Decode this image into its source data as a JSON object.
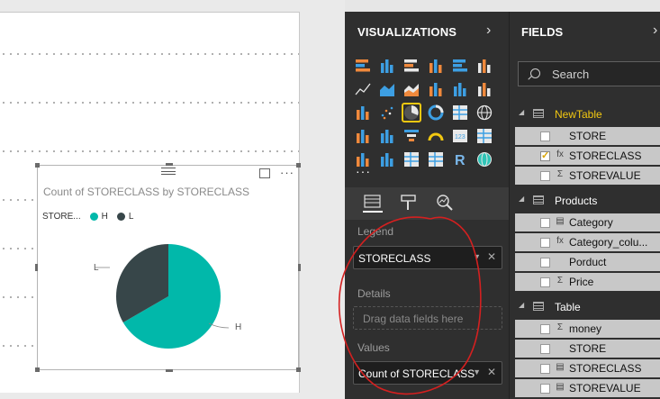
{
  "visual": {
    "title": "Count of STORECLASS by STORECLASS",
    "legend_title": "STORE...",
    "legend_items": [
      {
        "label": "H",
        "color": "#01b8aa"
      },
      {
        "label": "L",
        "color": "#374649"
      }
    ],
    "pie_labels": {
      "h": "H",
      "l": "L"
    }
  },
  "chart_data": {
    "type": "pie",
    "title": "Count of STORECLASS by STORECLASS",
    "legend_title": "STORE...",
    "slices": [
      {
        "label": "H",
        "value": 2,
        "color": "#01b8aa"
      },
      {
        "label": "L",
        "value": 1,
        "color": "#374649"
      }
    ]
  },
  "visualizations": {
    "header": "VISUALIZATIONS",
    "chevron": "›",
    "more": "···",
    "icons": [
      "stacked-bar-icon",
      "stacked-column-icon",
      "clustered-bar-icon",
      "clustered-column-icon",
      "100-stacked-bar-icon",
      "100-stacked-column-icon",
      "line-chart-icon",
      "area-chart-icon",
      "stacked-area-icon",
      "line-clustered-column-icon",
      "line-stacked-column-icon",
      "ribbon-chart-icon",
      "waterfall-chart-icon",
      "scatter-chart-icon",
      "pie-chart-icon",
      "donut-chart-icon",
      "treemap-icon",
      "map-icon",
      "filled-map-icon",
      "shape-map-icon",
      "funnel-icon",
      "gauge-icon",
      "card-icon",
      "multi-row-card-icon",
      "kpi-icon",
      "slicer-icon",
      "table-icon",
      "matrix-icon",
      "r-script-icon",
      "globe-icon"
    ],
    "selected_icon": "pie-chart-icon",
    "wells": {
      "legend_label": "Legend",
      "legend_value": "STORECLASS",
      "details_label": "Details",
      "details_placeholder": "Drag data fields here",
      "values_label": "Values",
      "values_value": "Count of STORECLASS"
    }
  },
  "fields": {
    "header": "FIELDS",
    "close": "›",
    "search_placeholder": "Search",
    "tables": [
      {
        "name": "NewTable",
        "active": true,
        "fields": [
          {
            "name": "STORE",
            "type": "",
            "checked": false
          },
          {
            "name": "STORECLASS",
            "type": "fx",
            "checked": true
          },
          {
            "name": "STOREVALUE",
            "type": "Σ",
            "checked": false
          }
        ]
      },
      {
        "name": "Products",
        "active": false,
        "fields": [
          {
            "name": "Category",
            "type": "▤",
            "checked": false
          },
          {
            "name": "Category_colu...",
            "type": "fx",
            "checked": false
          },
          {
            "name": "Porduct",
            "type": "",
            "checked": false
          },
          {
            "name": "Price",
            "type": "Σ",
            "checked": false
          }
        ]
      },
      {
        "name": "Table",
        "active": false,
        "fields": [
          {
            "name": "money",
            "type": "Σ",
            "checked": false
          },
          {
            "name": "STORE",
            "type": "",
            "checked": false
          },
          {
            "name": "STORECLASS",
            "type": "▤",
            "checked": false
          },
          {
            "name": "STOREVALUE",
            "type": "▤",
            "checked": false
          }
        ]
      }
    ]
  },
  "colors": {
    "accent": "#f2c811",
    "teal": "#01b8aa",
    "dark_slate": "#374649",
    "annotation": "#d42020"
  }
}
